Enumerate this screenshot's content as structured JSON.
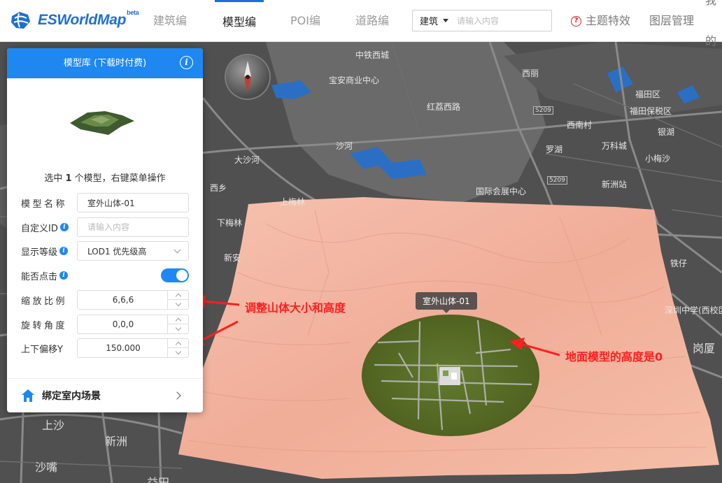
{
  "app": {
    "logo_text": "ESWorldMap",
    "logo_badge": "beta"
  },
  "nav": {
    "tabs": [
      {
        "label": "建筑编",
        "active": false
      },
      {
        "label": "模型编",
        "active": true
      },
      {
        "label": "POI编",
        "active": false
      },
      {
        "label": "道路编",
        "active": false
      }
    ]
  },
  "search": {
    "type_label": "建筑",
    "placeholder": "请输入内容"
  },
  "toolbar": {
    "theme_label": "主题特效",
    "layers_label": "图层管理",
    "mine_label": "我的"
  },
  "panel": {
    "title": "模型库 (下载时付费)",
    "selection": {
      "prefix": "选中 ",
      "count": "1",
      "suffix": " 个模型，右键菜单操作"
    },
    "fields": {
      "name_label": "模型名称",
      "name_value": "室外山体-01",
      "custom_id_label": "自定义ID",
      "custom_id_placeholder": "请输入内容",
      "lod_label": "显示等级",
      "lod_value": "LOD1 优先级高",
      "clickable_label": "能否点击",
      "clickable_on": true,
      "scale_label": "缩放比例",
      "scale_value": "6,6,6",
      "rotation_label": "旋转角度",
      "rotation_value": "0,0,0",
      "offset_label": "上下偏移Y",
      "offset_value": "150.000"
    },
    "footer_label": "绑定室内场景"
  },
  "map": {
    "model_label": "室外山体-01",
    "annotations": {
      "left": "调整山体大小和高度",
      "right": "地面模型的高度是0"
    },
    "labels": [
      "中铁西城",
      "西丽",
      "上沙",
      "新洲",
      "沙嘴",
      "益田",
      "福田区",
      "大沙河",
      "上梅林",
      "沙河",
      "西南村",
      "万科城",
      "宝安商业中心",
      "国际会展中心",
      "新洲站",
      "小梅沙",
      "铁仔",
      "深圳中学(西校区)",
      "福田保税区",
      "银湖",
      "岗厦",
      "罗湖",
      "西乡",
      "下梅林",
      "新安",
      "红荔西路"
    ],
    "road_badges": [
      "S209",
      "5209"
    ]
  },
  "colors": {
    "accent": "#1e88f0",
    "annotation": "#ff1f1f",
    "terrain": "#f2b4a0",
    "ground": "#5a6b2a"
  }
}
